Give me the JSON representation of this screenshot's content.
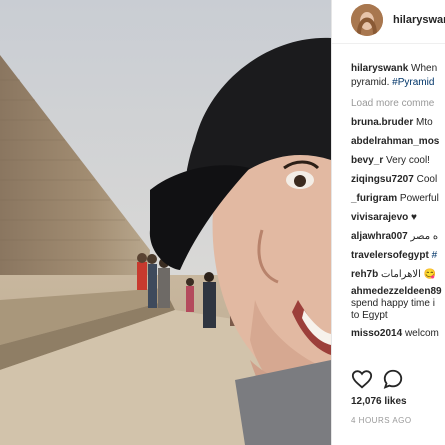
{
  "header": {
    "username": "hilaryswank"
  },
  "caption": {
    "username": "hilaryswank",
    "text": "When",
    "line2": "pyramid.",
    "hashtag": "#Pyramid"
  },
  "load_more": "Load more comme",
  "comments": [
    {
      "user": "bruna.bruder",
      "text": "Mto"
    },
    {
      "user": "abdelrahman_mos",
      "text": ""
    },
    {
      "user": "bevy_r",
      "text": "Very cool!"
    },
    {
      "user": "ziqingsu7207",
      "text": "Cool"
    },
    {
      "user": "_furigram",
      "text": "Powerful"
    },
    {
      "user": "vivisarajevo",
      "text": "♥"
    },
    {
      "user": "aljawhra007",
      "text": "ه مصر"
    },
    {
      "user": "travelersofegypt",
      "text": "#"
    },
    {
      "user": "reh7b",
      "text": "الاهرامات 😋"
    }
  ],
  "long_comment": {
    "user": "ahmedezzeldeen89",
    "line2": "spend happy time i",
    "line3": "to Egypt"
  },
  "last_comment": {
    "user": "misso2014",
    "text": "welcom"
  },
  "likes": "12,076 likes",
  "time": "4 HOURS AGO",
  "icons": [
    "heart-icon",
    "comment-icon"
  ],
  "colors": {
    "username": "#262626",
    "hashtag": "#003569",
    "muted": "#999999"
  }
}
